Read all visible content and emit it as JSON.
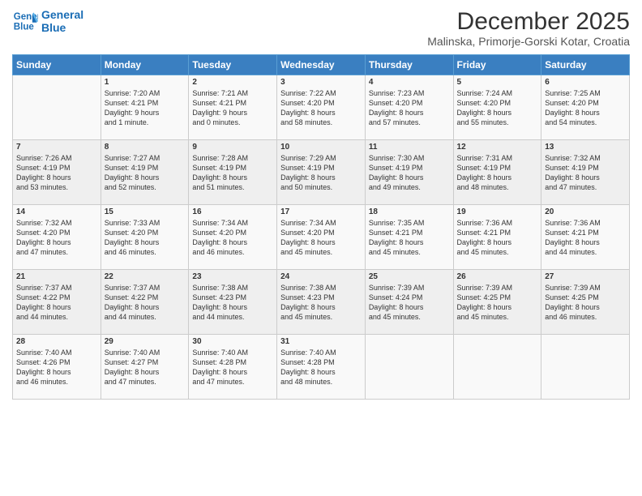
{
  "header": {
    "logo_line1": "General",
    "logo_line2": "Blue",
    "main_title": "December 2025",
    "subtitle": "Malinska, Primorje-Gorski Kotar, Croatia"
  },
  "days_header": [
    "Sunday",
    "Monday",
    "Tuesday",
    "Wednesday",
    "Thursday",
    "Friday",
    "Saturday"
  ],
  "weeks": [
    [
      {
        "day": "",
        "lines": []
      },
      {
        "day": "1",
        "lines": [
          "Sunrise: 7:20 AM",
          "Sunset: 4:21 PM",
          "Daylight: 9 hours",
          "and 1 minute."
        ]
      },
      {
        "day": "2",
        "lines": [
          "Sunrise: 7:21 AM",
          "Sunset: 4:21 PM",
          "Daylight: 9 hours",
          "and 0 minutes."
        ]
      },
      {
        "day": "3",
        "lines": [
          "Sunrise: 7:22 AM",
          "Sunset: 4:20 PM",
          "Daylight: 8 hours",
          "and 58 minutes."
        ]
      },
      {
        "day": "4",
        "lines": [
          "Sunrise: 7:23 AM",
          "Sunset: 4:20 PM",
          "Daylight: 8 hours",
          "and 57 minutes."
        ]
      },
      {
        "day": "5",
        "lines": [
          "Sunrise: 7:24 AM",
          "Sunset: 4:20 PM",
          "Daylight: 8 hours",
          "and 55 minutes."
        ]
      },
      {
        "day": "6",
        "lines": [
          "Sunrise: 7:25 AM",
          "Sunset: 4:20 PM",
          "Daylight: 8 hours",
          "and 54 minutes."
        ]
      }
    ],
    [
      {
        "day": "7",
        "lines": [
          "Sunrise: 7:26 AM",
          "Sunset: 4:19 PM",
          "Daylight: 8 hours",
          "and 53 minutes."
        ]
      },
      {
        "day": "8",
        "lines": [
          "Sunrise: 7:27 AM",
          "Sunset: 4:19 PM",
          "Daylight: 8 hours",
          "and 52 minutes."
        ]
      },
      {
        "day": "9",
        "lines": [
          "Sunrise: 7:28 AM",
          "Sunset: 4:19 PM",
          "Daylight: 8 hours",
          "and 51 minutes."
        ]
      },
      {
        "day": "10",
        "lines": [
          "Sunrise: 7:29 AM",
          "Sunset: 4:19 PM",
          "Daylight: 8 hours",
          "and 50 minutes."
        ]
      },
      {
        "day": "11",
        "lines": [
          "Sunrise: 7:30 AM",
          "Sunset: 4:19 PM",
          "Daylight: 8 hours",
          "and 49 minutes."
        ]
      },
      {
        "day": "12",
        "lines": [
          "Sunrise: 7:31 AM",
          "Sunset: 4:19 PM",
          "Daylight: 8 hours",
          "and 48 minutes."
        ]
      },
      {
        "day": "13",
        "lines": [
          "Sunrise: 7:32 AM",
          "Sunset: 4:19 PM",
          "Daylight: 8 hours",
          "and 47 minutes."
        ]
      }
    ],
    [
      {
        "day": "14",
        "lines": [
          "Sunrise: 7:32 AM",
          "Sunset: 4:20 PM",
          "Daylight: 8 hours",
          "and 47 minutes."
        ]
      },
      {
        "day": "15",
        "lines": [
          "Sunrise: 7:33 AM",
          "Sunset: 4:20 PM",
          "Daylight: 8 hours",
          "and 46 minutes."
        ]
      },
      {
        "day": "16",
        "lines": [
          "Sunrise: 7:34 AM",
          "Sunset: 4:20 PM",
          "Daylight: 8 hours",
          "and 46 minutes."
        ]
      },
      {
        "day": "17",
        "lines": [
          "Sunrise: 7:34 AM",
          "Sunset: 4:20 PM",
          "Daylight: 8 hours",
          "and 45 minutes."
        ]
      },
      {
        "day": "18",
        "lines": [
          "Sunrise: 7:35 AM",
          "Sunset: 4:21 PM",
          "Daylight: 8 hours",
          "and 45 minutes."
        ]
      },
      {
        "day": "19",
        "lines": [
          "Sunrise: 7:36 AM",
          "Sunset: 4:21 PM",
          "Daylight: 8 hours",
          "and 45 minutes."
        ]
      },
      {
        "day": "20",
        "lines": [
          "Sunrise: 7:36 AM",
          "Sunset: 4:21 PM",
          "Daylight: 8 hours",
          "and 44 minutes."
        ]
      }
    ],
    [
      {
        "day": "21",
        "lines": [
          "Sunrise: 7:37 AM",
          "Sunset: 4:22 PM",
          "Daylight: 8 hours",
          "and 44 minutes."
        ]
      },
      {
        "day": "22",
        "lines": [
          "Sunrise: 7:37 AM",
          "Sunset: 4:22 PM",
          "Daylight: 8 hours",
          "and 44 minutes."
        ]
      },
      {
        "day": "23",
        "lines": [
          "Sunrise: 7:38 AM",
          "Sunset: 4:23 PM",
          "Daylight: 8 hours",
          "and 44 minutes."
        ]
      },
      {
        "day": "24",
        "lines": [
          "Sunrise: 7:38 AM",
          "Sunset: 4:23 PM",
          "Daylight: 8 hours",
          "and 45 minutes."
        ]
      },
      {
        "day": "25",
        "lines": [
          "Sunrise: 7:39 AM",
          "Sunset: 4:24 PM",
          "Daylight: 8 hours",
          "and 45 minutes."
        ]
      },
      {
        "day": "26",
        "lines": [
          "Sunrise: 7:39 AM",
          "Sunset: 4:25 PM",
          "Daylight: 8 hours",
          "and 45 minutes."
        ]
      },
      {
        "day": "27",
        "lines": [
          "Sunrise: 7:39 AM",
          "Sunset: 4:25 PM",
          "Daylight: 8 hours",
          "and 46 minutes."
        ]
      }
    ],
    [
      {
        "day": "28",
        "lines": [
          "Sunrise: 7:40 AM",
          "Sunset: 4:26 PM",
          "Daylight: 8 hours",
          "and 46 minutes."
        ]
      },
      {
        "day": "29",
        "lines": [
          "Sunrise: 7:40 AM",
          "Sunset: 4:27 PM",
          "Daylight: 8 hours",
          "and 47 minutes."
        ]
      },
      {
        "day": "30",
        "lines": [
          "Sunrise: 7:40 AM",
          "Sunset: 4:28 PM",
          "Daylight: 8 hours",
          "and 47 minutes."
        ]
      },
      {
        "day": "31",
        "lines": [
          "Sunrise: 7:40 AM",
          "Sunset: 4:28 PM",
          "Daylight: 8 hours",
          "and 48 minutes."
        ]
      },
      {
        "day": "",
        "lines": []
      },
      {
        "day": "",
        "lines": []
      },
      {
        "day": "",
        "lines": []
      }
    ]
  ]
}
